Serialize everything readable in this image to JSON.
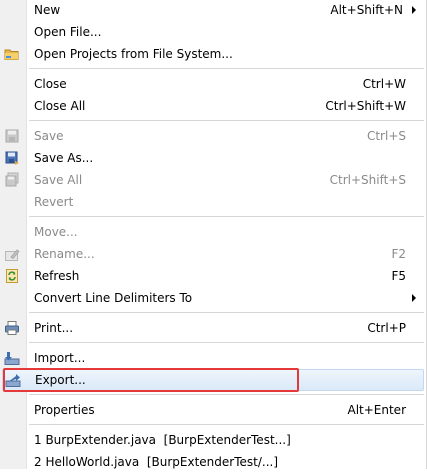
{
  "menu": {
    "new": {
      "label": "New",
      "shortcut": "Alt+Shift+N"
    },
    "open_file": {
      "label": "Open File..."
    },
    "open_projects": {
      "label": "Open Projects from File System..."
    },
    "close": {
      "label": "Close",
      "shortcut": "Ctrl+W"
    },
    "close_all": {
      "label": "Close All",
      "shortcut": "Ctrl+Shift+W"
    },
    "save": {
      "label": "Save",
      "shortcut": "Ctrl+S"
    },
    "save_as": {
      "label": "Save As..."
    },
    "save_all": {
      "label": "Save All",
      "shortcut": "Ctrl+Shift+S"
    },
    "revert": {
      "label": "Revert"
    },
    "move": {
      "label": "Move..."
    },
    "rename": {
      "label": "Rename...",
      "shortcut": "F2"
    },
    "refresh": {
      "label": "Refresh",
      "shortcut": "F5"
    },
    "convert": {
      "label": "Convert Line Delimiters To"
    },
    "print": {
      "label": "Print...",
      "shortcut": "Ctrl+P"
    },
    "import": {
      "label": "Import..."
    },
    "export": {
      "label": "Export..."
    },
    "properties": {
      "label": "Properties",
      "shortcut": "Alt+Enter"
    },
    "recent1": {
      "label": "1 BurpExtender.java  [BurpExtenderTest...]"
    },
    "recent2": {
      "label": "2 HelloWorld.java  [BurpExtenderTest/...]"
    }
  },
  "colors": {
    "highlight_outline": "#e53939",
    "hover_background": "#dbe9f8",
    "disabled_text": "#8a8a8a"
  }
}
